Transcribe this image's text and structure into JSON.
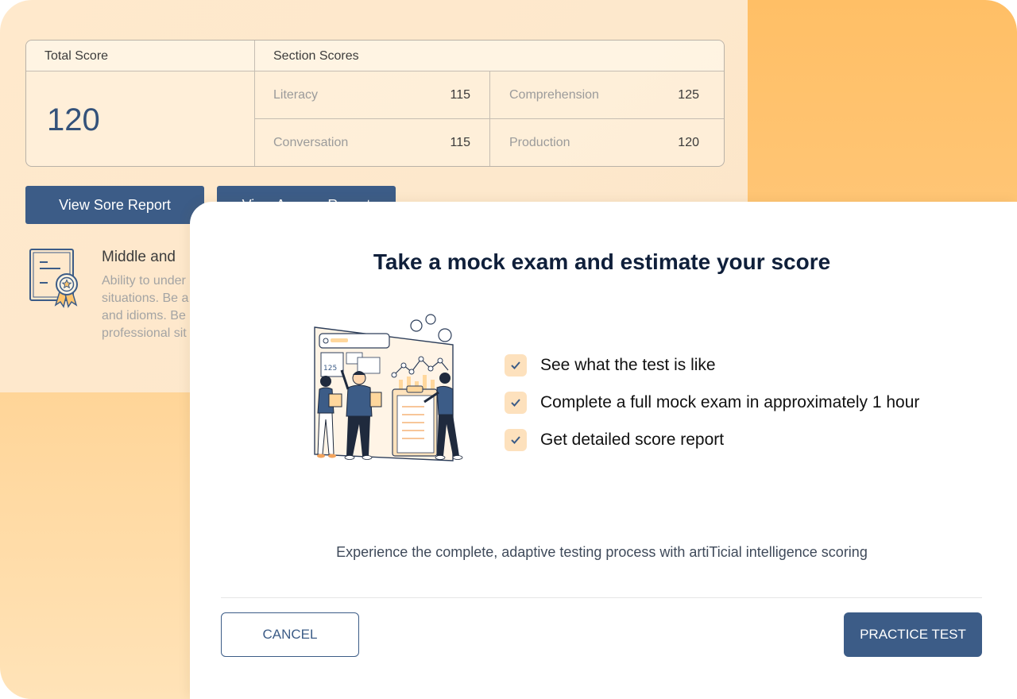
{
  "score_table": {
    "total_header": "Total Score",
    "section_header": "Section Scores",
    "total_value": "120",
    "sections": [
      {
        "label": "Literacy",
        "value": "115"
      },
      {
        "label": "Comprehension",
        "value": "125"
      },
      {
        "label": "Conversation",
        "value": "115"
      },
      {
        "label": "Production",
        "value": "120"
      }
    ]
  },
  "actions": {
    "view_score_report": "View Sore Report",
    "view_answer_report": "View Answer Report"
  },
  "level": {
    "title": "Middle and",
    "desc_lines": [
      "Ability to under",
      "situations. Be a",
      "and idioms. Be",
      "professional sit"
    ]
  },
  "modal": {
    "title": "Take a mock exam and estimate your score",
    "features": [
      "See what the test is like",
      "Complete a full mock exam in approximately 1 hour",
      "Get detailed score report"
    ],
    "subtitle": "Experience the complete, adaptive testing process with artiTicial intelligence scoring",
    "cancel_label": "CANCEL",
    "practice_label": "PRACTICE TEST",
    "illustration_score": "125"
  },
  "colors": {
    "primary": "#3c5c87",
    "accent_orange": "#ffbf66",
    "check_bg": "#fde1bd"
  }
}
